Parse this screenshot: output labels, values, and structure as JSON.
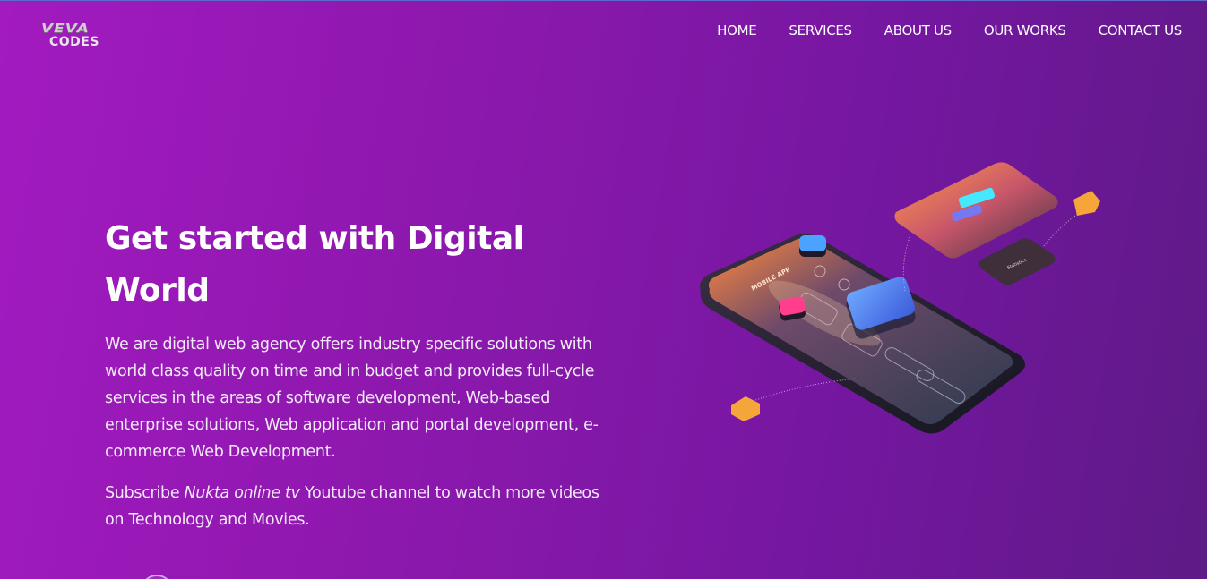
{
  "brand": {
    "logo_line1": "VEVA",
    "logo_line2": "CODES"
  },
  "nav": {
    "items": [
      {
        "label": "HOME"
      },
      {
        "label": "SERVICES"
      },
      {
        "label": "ABOUT US"
      },
      {
        "label": "OUR WORKS"
      },
      {
        "label": "CONTACT US"
      }
    ]
  },
  "hero": {
    "title": "Get started with Digital World",
    "description": "We are digital web agency offers industry specific solutions with world class quality on time and in budget and provides full-cycle services in the areas of software development, Web-based enterprise solutions, Web application and portal development, e-commerce Web Development.",
    "subscribe_prefix": "Subscribe ",
    "subscribe_channel": "Nukta online tv",
    "subscribe_suffix": " Youtube channel to watch more videos on Technology and Movies."
  },
  "illustration": {
    "phone_label": "MOBILE APP",
    "card_label": "Statistics",
    "subject": "isometric-mobile-app-icon"
  },
  "colors": {
    "bg_start": "#a21ac0",
    "bg_end": "#5e1a86",
    "text": "#ffffff"
  }
}
